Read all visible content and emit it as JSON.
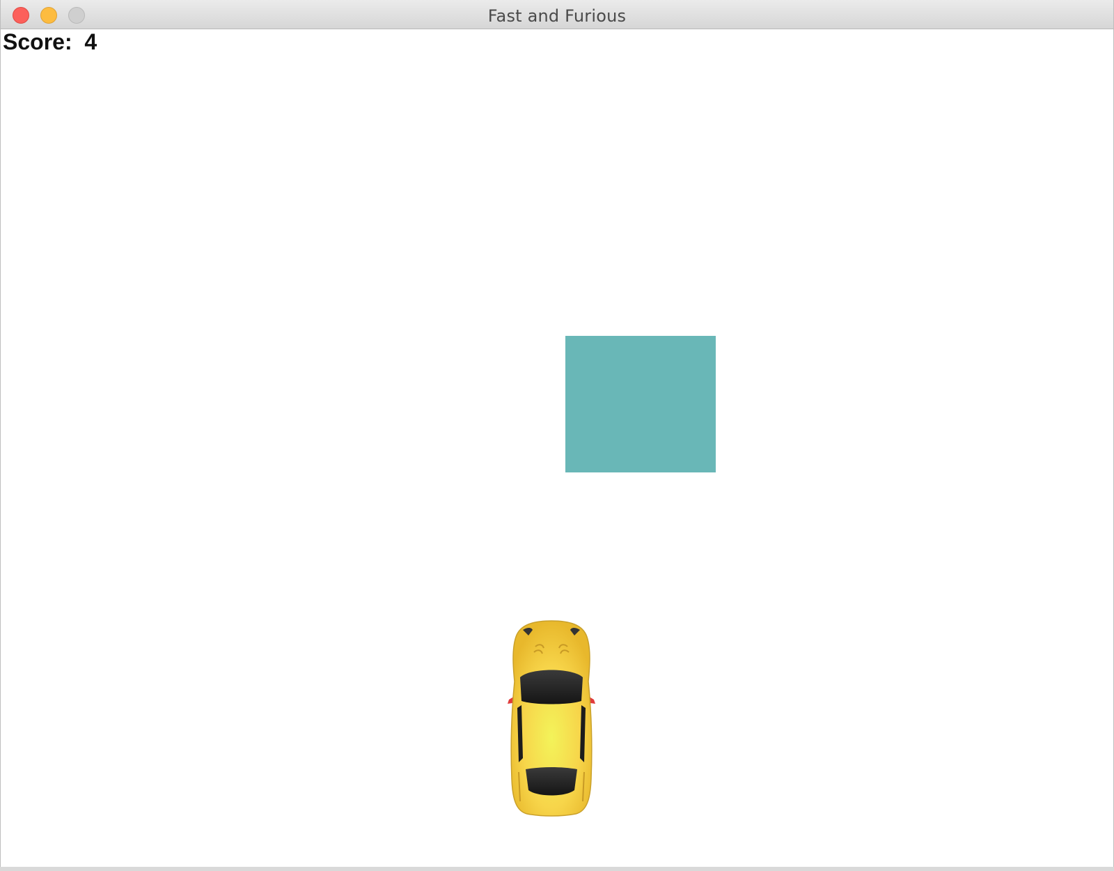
{
  "window": {
    "title": "Fast and Furious"
  },
  "hud": {
    "score_label": "Score:  4",
    "score": 4
  },
  "obstacle": {
    "color": "#69b7b7",
    "shape": "square"
  },
  "player": {
    "sprite": "yellow-sports-car-icon",
    "body_color": "#f5d03f",
    "glass_color": "#222222",
    "mirror_color": "#e03b3b"
  },
  "icons": {
    "close": "close-icon",
    "minimize": "minimize-icon",
    "maximize": "maximize-icon"
  }
}
